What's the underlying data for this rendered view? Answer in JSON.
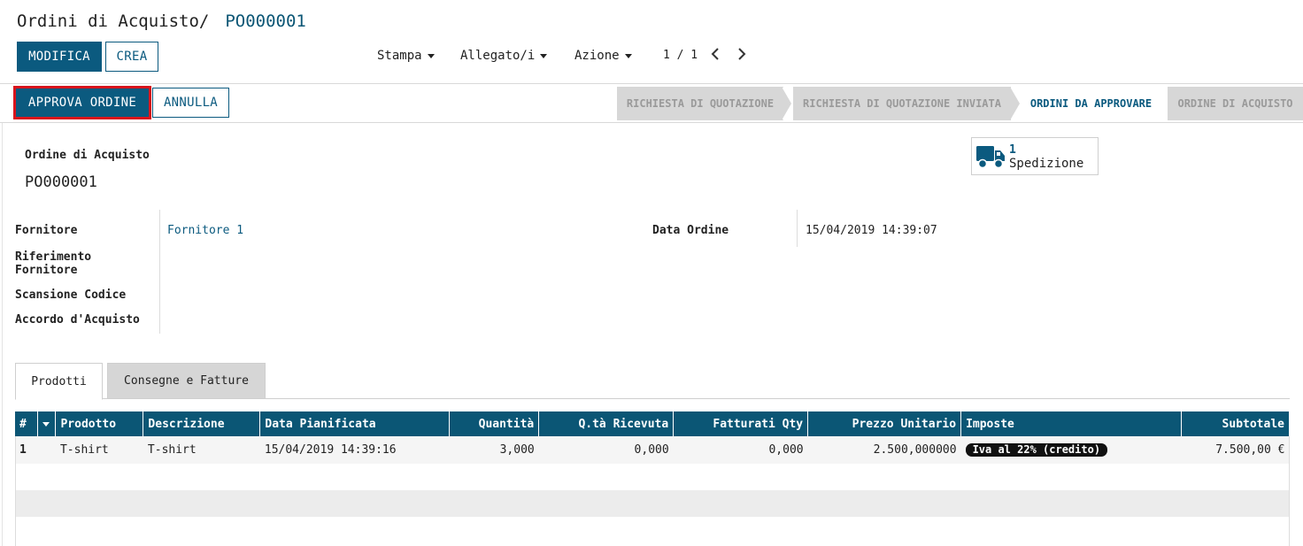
{
  "breadcrumb": {
    "parent": "Ordini di Acquisto",
    "separator": "/",
    "current": "PO000001"
  },
  "toolbar": {
    "edit_label": "MODIFICA",
    "create_label": "CREA",
    "print_label": "Stampa",
    "attachments_label": "Allegato/i",
    "action_label": "Azione"
  },
  "pager": {
    "value": "1 / 1"
  },
  "statusbar": {
    "approve_label": "APPROVA ORDINE",
    "cancel_label": "ANNULLA",
    "stages": [
      "RICHIESTA DI QUOTAZIONE",
      "RICHIESTA DI QUOTAZIONE INVIATA",
      "ORDINI DA APPROVARE",
      "ORDINE DI ACQUISTO"
    ],
    "active_stage": "ORDINI DA APPROVARE"
  },
  "smart_button": {
    "count": "1",
    "label": "Spedizione",
    "icon": "truck-icon"
  },
  "form": {
    "type_label": "Ordine di Acquisto",
    "name": "PO000001",
    "vendor_label": "Fornitore",
    "vendor_value": "Fornitore 1",
    "vendor_ref_label_1": "Riferimento",
    "vendor_ref_label_2": "Fornitore",
    "barcode_label": "Scansione Codice",
    "agreement_label": "Accordo d'Acquisto",
    "date_label": "Data Ordine",
    "date_value": "15/04/2019 14:39:07"
  },
  "tabs": {
    "products": "Prodotti",
    "shipments": "Consegne e Fatture"
  },
  "lines": {
    "headers": {
      "seq": "#",
      "product": "Prodotto",
      "description": "Descrizione",
      "date": "Data Pianificata",
      "qty": "Quantità",
      "received": "Q.tà Ricevuta",
      "invoiced": "Fatturati Qty",
      "price": "Prezzo Unitario",
      "taxes": "Imposte",
      "subtotal": "Subtotale"
    },
    "rows": [
      {
        "seq": "1",
        "product": "T-shirt",
        "description": "T-shirt",
        "date": "15/04/2019 14:39:16",
        "qty": "3,000",
        "received": "0,000",
        "invoiced": "0,000",
        "price": "2.500,000000",
        "tax": "Iva al 22% (credito)",
        "subtotal": "7.500,00 €"
      }
    ]
  },
  "colors": {
    "primary": "#0b5a7f",
    "header": "#0b5675",
    "highlight": "#d8141c"
  }
}
